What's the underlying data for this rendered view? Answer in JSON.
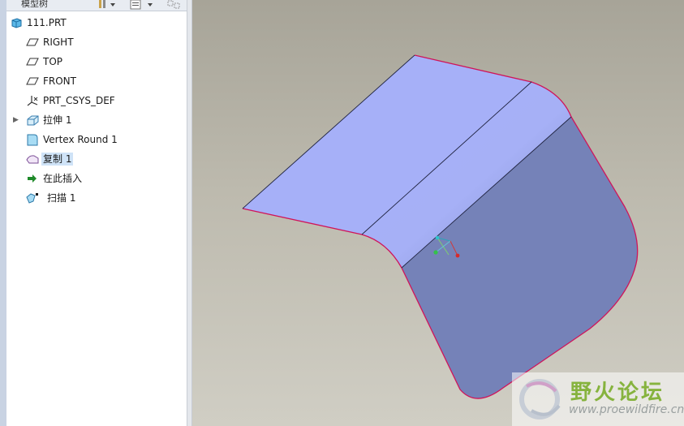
{
  "model_tree": {
    "toolbar_label": "模型树",
    "items": [
      {
        "label": "111.PRT",
        "icon": "part-icon",
        "expandable": false,
        "selected": false
      },
      {
        "label": "RIGHT",
        "icon": "datum-plane-icon",
        "expandable": false,
        "selected": false
      },
      {
        "label": "TOP",
        "icon": "datum-plane-icon",
        "expandable": false,
        "selected": false
      },
      {
        "label": "FRONT",
        "icon": "datum-plane-icon",
        "expandable": false,
        "selected": false
      },
      {
        "label": "PRT_CSYS_DEF",
        "icon": "coordinate-system-icon",
        "expandable": false,
        "selected": false
      },
      {
        "label": "拉伸 1",
        "icon": "extrude-icon",
        "expandable": true,
        "selected": false
      },
      {
        "label": "Vertex Round 1",
        "icon": "vertex-round-icon",
        "expandable": false,
        "selected": false
      },
      {
        "label": "复制 1",
        "icon": "copy-surface-icon",
        "expandable": false,
        "selected": true
      },
      {
        "label": "在此插入",
        "icon": "insert-here-arrow-icon",
        "expandable": false,
        "selected": false
      },
      {
        "label": "扫描 1",
        "icon": "sweep-icon",
        "expandable": false,
        "selected": false
      }
    ]
  },
  "watermark": {
    "title": "野火论坛",
    "url": "www.proewildfire.cn"
  },
  "colors": {
    "surface_light": "#a6b0f8",
    "surface_dark": "#7582b8",
    "edge_highlight": "#d0145a",
    "viewport_top": "#a7a498",
    "viewport_bottom": "#d0cec4",
    "selection": "#cfe3f7"
  }
}
